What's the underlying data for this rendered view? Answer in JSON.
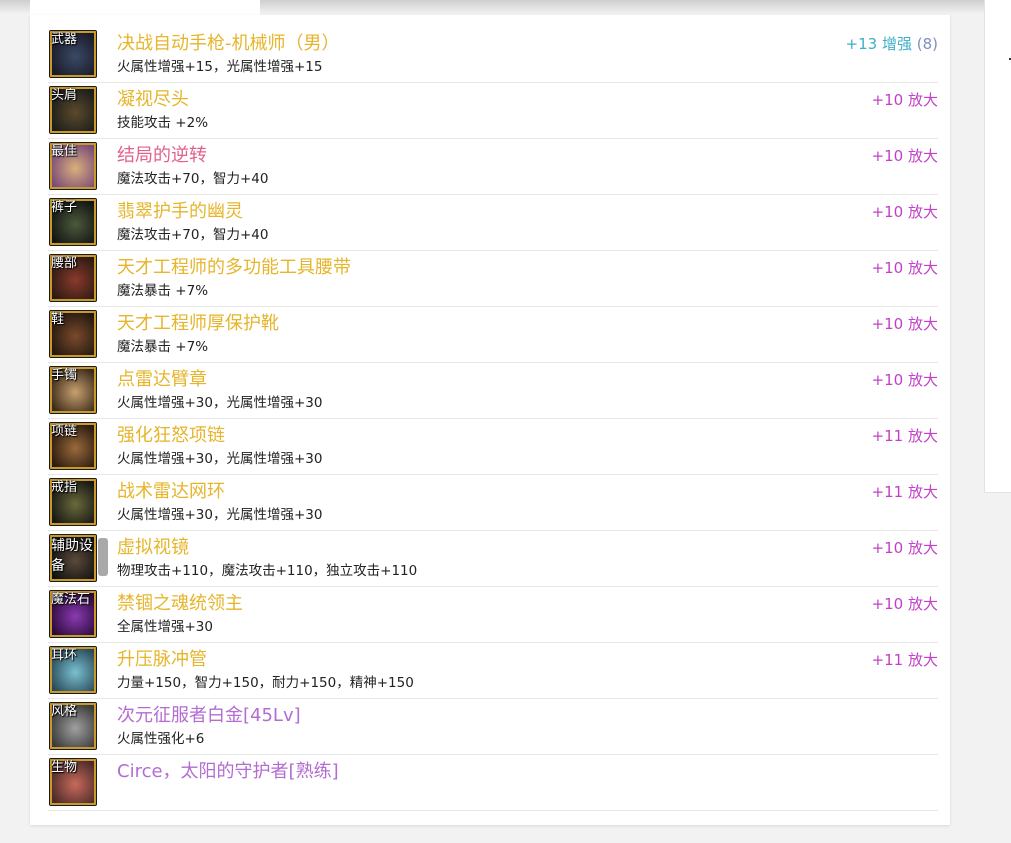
{
  "items": [
    {
      "slot": "武器",
      "name": "决战自动手枪-机械师（男）",
      "stats": "火属性增强+15，光属性增强+15",
      "enh": "+13 增强",
      "enh_count": "(8)",
      "name_color": "#e6b52b",
      "enh_color": "#3cb0c9",
      "icon_bg": [
        "#3a4a66",
        "#1a1a28"
      ]
    },
    {
      "slot": "头肩",
      "name": "凝视尽头",
      "stats": "技能攻击 +2%",
      "enh": "+10 放大",
      "enh_count": "",
      "name_color": "#e6b52b",
      "enh_color": "#c23fc6",
      "icon_bg": [
        "#5b4a2a",
        "#1c1c1c"
      ]
    },
    {
      "slot": "最佳",
      "name": "结局的逆转",
      "stats": "魔法攻击+70，智力+40",
      "enh": "+10 放大",
      "enh_count": "",
      "name_color": "#e0628c",
      "enh_color": "#c23fc6",
      "icon_bg": [
        "#d9b07a",
        "#7a4a7a"
      ]
    },
    {
      "slot": "裤子",
      "name": "翡翠护手的幽灵",
      "stats": "魔法攻击+70，智力+40",
      "enh": "+10 放大",
      "enh_count": "",
      "name_color": "#e6b52b",
      "enh_color": "#c23fc6",
      "icon_bg": [
        "#4a5a3a",
        "#141414"
      ]
    },
    {
      "slot": "腰部",
      "name": "天才工程师的多功能工具腰带",
      "stats": "魔法暴击 +7%",
      "enh": "+10 放大",
      "enh_count": "",
      "name_color": "#e6b52b",
      "enh_color": "#c23fc6",
      "icon_bg": [
        "#8a3a2a",
        "#2a1a14"
      ]
    },
    {
      "slot": "鞋",
      "name": "天才工程师厚保护靴",
      "stats": "魔法暴击 +7%",
      "enh": "+10 放大",
      "enh_count": "",
      "name_color": "#e6b52b",
      "enh_color": "#c23fc6",
      "icon_bg": [
        "#7a4a2a",
        "#221810"
      ]
    },
    {
      "slot": "手镯",
      "name": "点雷达臂章",
      "stats": "火属性增强+30，光属性增强+30",
      "enh": "+10 放大",
      "enh_count": "",
      "name_color": "#e6b52b",
      "enh_color": "#c23fc6",
      "icon_bg": [
        "#c8a070",
        "#3a2a1a"
      ]
    },
    {
      "slot": "项链",
      "name": "强化狂怒项链",
      "stats": "火属性增强+30，光属性增强+30",
      "enh": "+11 放大",
      "enh_count": "",
      "name_color": "#e6b52b",
      "enh_color": "#c23fc6",
      "icon_bg": [
        "#9a6a3a",
        "#2a1a10"
      ]
    },
    {
      "slot": "戒指",
      "name": "战术雷达网环",
      "stats": "火属性增强+30，光属性增强+30",
      "enh": "+11 放大",
      "enh_count": "",
      "name_color": "#e6b52b",
      "enh_color": "#c23fc6",
      "icon_bg": [
        "#6a6a3a",
        "#161616"
      ]
    },
    {
      "slot": "辅助设备",
      "name": "虚拟视镜",
      "stats": "物理攻击+110，魔法攻击+110，独立攻击+110",
      "enh": "+10 放大",
      "enh_count": "",
      "name_color": "#e6b52b",
      "enh_color": "#c23fc6",
      "icon_bg": [
        "#5a4a3a",
        "#101010"
      ]
    },
    {
      "slot": "魔法石",
      "name": "禁锢之魂统领主",
      "stats": "全属性增强+30",
      "enh": "+10 放大",
      "enh_count": "",
      "name_color": "#e6b52b",
      "enh_color": "#c23fc6",
      "icon_bg": [
        "#8a3ab0",
        "#2a0a3a"
      ]
    },
    {
      "slot": "耳环",
      "name": "升压脉冲管",
      "stats": "力量+150，智力+150，耐力+150，精神+150",
      "enh": "+11 放大",
      "enh_count": "",
      "name_color": "#e6b52b",
      "enh_color": "#c23fc6",
      "icon_bg": [
        "#7ac0d0",
        "#2a4a5a"
      ]
    },
    {
      "slot": "风格",
      "name": "次元征服者白金[45Lv]",
      "stats": "火属性强化+6",
      "enh": "",
      "enh_count": "",
      "name_color": "#b36cd1",
      "enh_color": "#c23fc6",
      "icon_bg": [
        "#a0a0a0",
        "#3a3a3a"
      ]
    },
    {
      "slot": "生物",
      "name": "Circe，太阳的守护者[熟练]",
      "stats": "",
      "enh": "",
      "enh_count": "",
      "name_color": "#b36cd1",
      "enh_color": "#c23fc6",
      "icon_bg": [
        "#c86a5a",
        "#4a2a2a"
      ]
    }
  ]
}
